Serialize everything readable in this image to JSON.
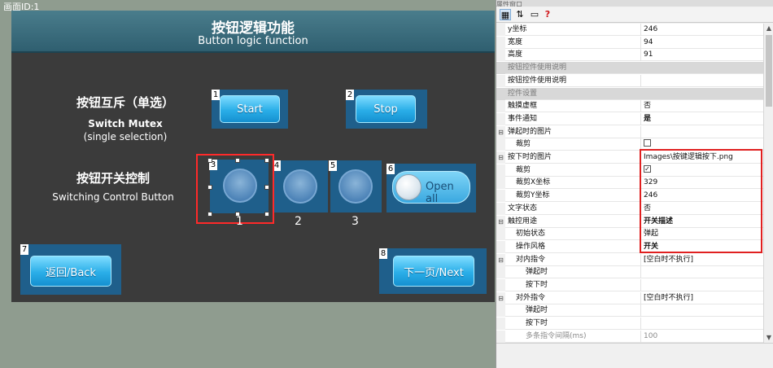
{
  "screen": {
    "label": "画面ID:1"
  },
  "header": {
    "title_cn": "按钮逻辑功能",
    "title_en": "Button logic function"
  },
  "mutex": {
    "title_cn": "按钮互斥（单选）",
    "title_en1": "Switch Mutex",
    "title_en2": "(single selection)"
  },
  "switch_ctrl": {
    "title_cn": "按钮开关控制",
    "title_en": "Switching Control Button"
  },
  "buttons": {
    "start": {
      "index": "1",
      "label": "Start"
    },
    "stop": {
      "index": "2",
      "label": "Stop"
    },
    "round1": {
      "index": "3",
      "caption": "1"
    },
    "round2": {
      "index": "4",
      "caption": "2"
    },
    "round3": {
      "index": "5",
      "caption": "3"
    },
    "open_all": {
      "index": "6",
      "label": "Open all"
    },
    "back": {
      "index": "7",
      "label": "返回/Back"
    },
    "next": {
      "index": "8",
      "label": "下一页/Next"
    }
  },
  "colors": {
    "selection": "#ff2a2a",
    "button": "#2aaee8",
    "header": "#3d6f7f",
    "canvas": "#3b3b3b"
  },
  "panel": {
    "title": "属性窗口",
    "toolbar": [
      "categorized-icon",
      "sort-az-icon",
      "property-pages-icon",
      "help-icon"
    ],
    "help_glyph": "?",
    "rows": [
      {
        "name": "y坐标",
        "value": "246"
      },
      {
        "name": "宽度",
        "value": "94"
      },
      {
        "name": "高度",
        "value": "91"
      },
      {
        "name": "按钮控件使用说明",
        "value": "",
        "cat": true
      },
      {
        "name": "按钮控件使用说明",
        "value": ""
      },
      {
        "name": "控件设置",
        "value": "",
        "cat": true
      },
      {
        "name": "触摸虚框",
        "value": "否"
      },
      {
        "name": "事件通知",
        "value": "是",
        "bold": true
      },
      {
        "name": "弹起时的图片",
        "value": "",
        "gutter": "⊟"
      },
      {
        "name": "裁剪",
        "value": "",
        "checkbox": "unchecked",
        "indent": true
      },
      {
        "name": "按下时的图片",
        "value": "Images\\按键逻辑按下.png",
        "gutter": "⊟"
      },
      {
        "name": "裁剪",
        "value": "",
        "checkbox": "checked",
        "indent": true
      },
      {
        "name": "裁剪X坐标",
        "value": "329",
        "indent": true
      },
      {
        "name": "裁剪Y坐标",
        "value": "246",
        "indent": true
      },
      {
        "name": "文字状态",
        "value": "否"
      },
      {
        "name": "触控用途",
        "value": "开关描述",
        "bold": true,
        "gutter": "⊟"
      },
      {
        "name": "初始状态",
        "value": "弹起",
        "indent": true
      },
      {
        "name": "操作风格",
        "value": "开关",
        "bold": true,
        "indent": true
      },
      {
        "name": "对内指令",
        "value": "[空白时不执行]",
        "gutter": "⊟",
        "indent": true
      },
      {
        "name": "弹起时",
        "value": "",
        "indent2": true
      },
      {
        "name": "按下时",
        "value": "",
        "indent2": true
      },
      {
        "name": "对外指令",
        "value": "[空白时不执行]",
        "gutter": "⊟",
        "indent": true
      },
      {
        "name": "弹起时",
        "value": "",
        "indent2": true
      },
      {
        "name": "按下时",
        "value": "",
        "indent2": true
      },
      {
        "name": "多条指令间隔(ms)",
        "value": "100",
        "gray": true,
        "indent2": true
      }
    ]
  }
}
